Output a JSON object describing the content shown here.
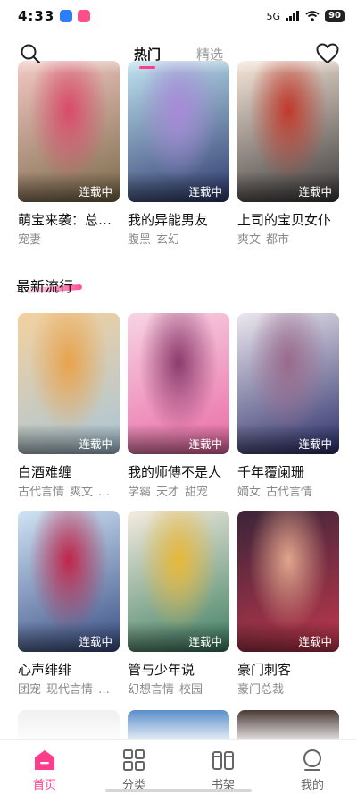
{
  "status_bar": {
    "time": "4:33",
    "battery": "90",
    "network": "5G"
  },
  "header": {
    "tabs": [
      {
        "label": "热门",
        "active": true
      },
      {
        "label": "精选",
        "active": false
      }
    ],
    "icons": {
      "left": "search-icon",
      "right": "heart-icon"
    }
  },
  "section": {
    "title": "最新流行"
  },
  "top_row": [
    {
      "title": "萌宝来袭：总…",
      "tags": [
        "宠妻"
      ],
      "status": "连载中",
      "colors": [
        "#f3c9c3",
        "#7b6a4a",
        "#d94a6a"
      ]
    },
    {
      "title": "我的异能男友",
      "tags": [
        "腹黑",
        "玄幻"
      ],
      "status": "连载中",
      "colors": [
        "#bfe3f0",
        "#2d3a6e",
        "#a88ad8"
      ]
    },
    {
      "title": "上司的宝贝女仆",
      "tags": [
        "爽文",
        "都市"
      ],
      "status": "连载中",
      "colors": [
        "#f6e6d8",
        "#3b3a3a",
        "#c0392b"
      ]
    }
  ],
  "popular": [
    {
      "title": "白酒难缠",
      "tags": [
        "古代言情",
        "爽文",
        "…"
      ],
      "status": "连载中",
      "colors": [
        "#f4d19e",
        "#a9c6d9",
        "#e8a34c"
      ]
    },
    {
      "title": "我的师傅不是人",
      "tags": [
        "学霸",
        "天才",
        "甜宠"
      ],
      "status": "连载中",
      "colors": [
        "#f7d4e4",
        "#e96aa4",
        "#8c3b6d"
      ]
    },
    {
      "title": "千年覆阑珊",
      "tags": [
        "嫡女",
        "古代言情"
      ],
      "status": "连载中",
      "colors": [
        "#ece7ee",
        "#2c2f6b",
        "#9a6a8c"
      ]
    },
    {
      "title": "心声绯绯",
      "tags": [
        "团宠",
        "现代言情",
        "…"
      ],
      "status": "连载中",
      "colors": [
        "#cfe4f4",
        "#3b4f86",
        "#c0254a"
      ]
    },
    {
      "title": "管与少年说",
      "tags": [
        "幻想言情",
        "校园"
      ],
      "status": "连载中",
      "colors": [
        "#f4ece0",
        "#3e7f62",
        "#e8b83a"
      ]
    },
    {
      "title": "豪门刺客",
      "tags": [
        "豪门总裁"
      ],
      "status": "连载中",
      "colors": [
        "#3a2438",
        "#c2384e",
        "#e0a58c"
      ]
    }
  ],
  "peek_colors": [
    "#f0f0f0",
    "#5a8fc9",
    "#4a3a36"
  ],
  "bottom_nav": [
    {
      "label": "首页",
      "icon": "home-icon",
      "active": true
    },
    {
      "label": "分类",
      "icon": "grid-icon",
      "active": false
    },
    {
      "label": "书架",
      "icon": "bookshelf-icon",
      "active": false
    },
    {
      "label": "我的",
      "icon": "profile-icon",
      "active": false
    }
  ],
  "accent": "#ff3d8b"
}
